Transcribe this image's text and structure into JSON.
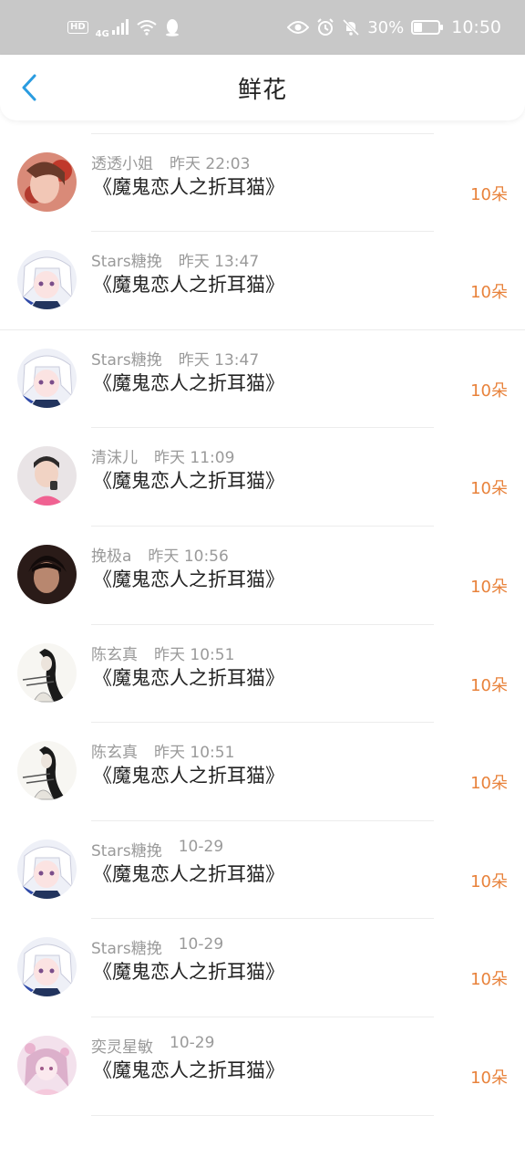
{
  "status_bar": {
    "left_icons": [
      "hd-icon",
      "signal-4g-icon",
      "wifi-icon",
      "qq-icon"
    ],
    "hd_label": "HD",
    "network_label": "4G",
    "right_icons": [
      "eye-icon",
      "alarm-icon",
      "mute-icon",
      "battery-icon"
    ],
    "battery": "30%",
    "battery_level": 0.3,
    "time": "10:50"
  },
  "header": {
    "title": "鲜花",
    "back_icon": "chevron-left-icon",
    "accent_color": "#2a9ce0"
  },
  "list": {
    "items": [
      {
        "user": "",
        "time": "",
        "book": "《魔鬼恋人之折耳猫》",
        "count": "10朵",
        "avatar": "avatar-red-girl"
      },
      {
        "user": "透透小姐",
        "time": "昨天 22:03",
        "book": "《魔鬼恋人之折耳猫》",
        "count": "10朵",
        "avatar": "avatar-red-girl"
      },
      {
        "user": "Stars糖挽",
        "time": "昨天 13:47",
        "book": "《魔鬼恋人之折耳猫》",
        "count": "10朵",
        "avatar": "avatar-anime-white"
      },
      {
        "user": "Stars糖挽",
        "time": "昨天 13:47",
        "book": "《魔鬼恋人之折耳猫》",
        "count": "10朵",
        "avatar": "avatar-anime-white"
      },
      {
        "user": "清沫儿",
        "time": "昨天 11:09",
        "book": "《魔鬼恋人之折耳猫》",
        "count": "10朵",
        "avatar": "avatar-boy-pink"
      },
      {
        "user": "挽极a",
        "time": "昨天 10:56",
        "book": "《魔鬼恋人之折耳猫》",
        "count": "10朵",
        "avatar": "avatar-dark-boy"
      },
      {
        "user": "陈玄真",
        "time": "昨天 10:51",
        "book": "《魔鬼恋人之折耳猫》",
        "count": "10朵",
        "avatar": "avatar-ink-painting"
      },
      {
        "user": "陈玄真",
        "time": "昨天 10:51",
        "book": "《魔鬼恋人之折耳猫》",
        "count": "10朵",
        "avatar": "avatar-ink-painting"
      },
      {
        "user": "Stars糖挽",
        "time": "10-29",
        "book": "《魔鬼恋人之折耳猫》",
        "count": "10朵",
        "avatar": "avatar-anime-white"
      },
      {
        "user": "Stars糖挽",
        "time": "10-29",
        "book": "《魔鬼恋人之折耳猫》",
        "count": "10朵",
        "avatar": "avatar-anime-white"
      },
      {
        "user": "奕灵星敏",
        "time": "10-29",
        "book": "《魔鬼恋人之折耳猫》",
        "count": "10朵",
        "avatar": "avatar-pink-anime"
      }
    ]
  },
  "colors": {
    "count": "#e8823b",
    "meta": "#9a9a9a",
    "text": "#222222",
    "status_bar_bg": "#c8c8c8"
  }
}
